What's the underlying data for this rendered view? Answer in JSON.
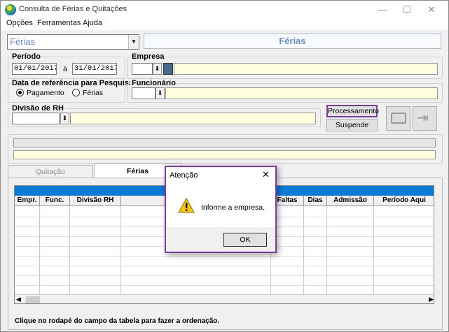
{
  "window": {
    "title": "Consulta de Férias e Quitações",
    "minimize": "—",
    "maximize": "☐",
    "close": "✕"
  },
  "menu": {
    "items": [
      "Opções",
      "Ferramentas",
      "Ajuda"
    ]
  },
  "top": {
    "type_select_value": "Férias",
    "header_label": "Férias"
  },
  "periodo": {
    "label": "Período",
    "start": "01/01/2017",
    "separator": "à",
    "end": "31/01/2017"
  },
  "empresa": {
    "label": "Empresa",
    "code": "",
    "name": ""
  },
  "data_ref": {
    "label": "Data de referência para Pesquisa",
    "option1": "Pagamento",
    "option2": "Férias",
    "selected": "Pagamento"
  },
  "funcionario": {
    "label": "Funcionário",
    "code": "",
    "name": ""
  },
  "divisao": {
    "label": "Divisão de RH",
    "code": "",
    "name": ""
  },
  "buttons": {
    "processamento": "Processamento",
    "suspende": "Suspende"
  },
  "tabs": [
    "Quitação",
    "Férias"
  ],
  "active_tab": "Férias",
  "grid": {
    "columns": [
      "Empr.",
      "Func.",
      "Divisão RH",
      "",
      "Faltas",
      "Dias",
      "Admissão",
      "Período Aqui"
    ]
  },
  "footer_hint": "Clique no rodapé do campo da tabela  para fazer a ordenação.",
  "dialog": {
    "title": "Atenção",
    "message": "Informe a empresa.",
    "ok_label": "OK",
    "close": "✕"
  },
  "icons": {
    "printer": "printer-icon",
    "export": "export-icon",
    "warning": "warning-icon"
  },
  "colors": {
    "accent": "#0c7bd6",
    "dialog_border": "#7a3ca0",
    "yellow_field": "#ffffe0",
    "header_text": "#6b8fc2"
  }
}
